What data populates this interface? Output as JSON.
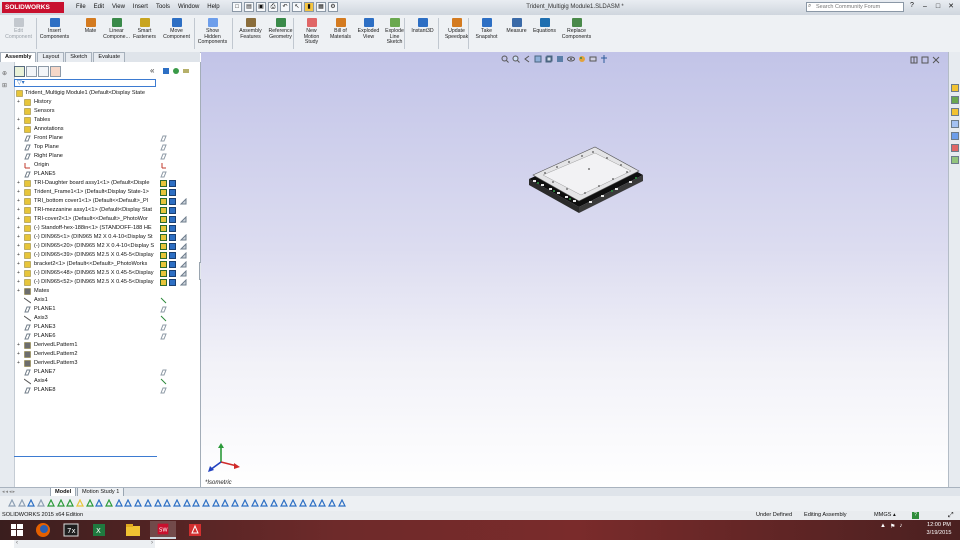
{
  "app": {
    "brand": "SOLIDWORKS",
    "document_title": "Trident_Multigig Module1.SLDASM *",
    "menu": [
      "File",
      "Edit",
      "View",
      "Insert",
      "Tools",
      "Window",
      "Help"
    ],
    "search_placeholder": "Search Community Forum",
    "window_controls": [
      "–",
      "□",
      "✕"
    ]
  },
  "commands": [
    {
      "label": "Edit\nComponent",
      "icon": "edit-component-icon",
      "enabled": false
    },
    {
      "label": "Insert\nComponents",
      "icon": "insert-components-icon",
      "enabled": true
    },
    {
      "label": "Mate",
      "icon": "mate-icon",
      "enabled": true
    },
    {
      "label": "Linear\nCompone...",
      "icon": "linear-pattern-icon",
      "enabled": true
    },
    {
      "label": "Smart\nFasteners",
      "icon": "smart-fasteners-icon",
      "enabled": true
    },
    {
      "label": "Move\nComponent",
      "icon": "move-component-icon",
      "enabled": true
    },
    {
      "label": "Show\nHidden\nComponents",
      "icon": "show-hidden-icon",
      "enabled": true
    },
    {
      "label": "Assembly\nFeatures",
      "icon": "assembly-features-icon",
      "enabled": true
    },
    {
      "label": "Reference\nGeometry",
      "icon": "reference-geometry-icon",
      "enabled": true
    },
    {
      "label": "New\nMotion\nStudy",
      "icon": "motion-study-icon",
      "enabled": true
    },
    {
      "label": "Bill of\nMaterials",
      "icon": "bom-icon",
      "enabled": true
    },
    {
      "label": "Exploded\nView",
      "icon": "exploded-view-icon",
      "enabled": true
    },
    {
      "label": "Explode\nLine\nSketch",
      "icon": "explode-line-icon",
      "enabled": true
    },
    {
      "label": "Instant3D",
      "icon": "instant3d-icon",
      "enabled": true
    },
    {
      "label": "Update\nSpeedpak",
      "icon": "speedpak-icon",
      "enabled": true
    },
    {
      "label": "Take\nSnapshot",
      "icon": "snapshot-icon",
      "enabled": true
    },
    {
      "label": "Measure",
      "icon": "measure-icon",
      "enabled": true
    },
    {
      "label": "Equations",
      "icon": "equations-icon",
      "enabled": true
    },
    {
      "label": "Replace\nComponents",
      "icon": "replace-components-icon",
      "enabled": true
    }
  ],
  "cm_tabs": [
    "Assembly",
    "Layout",
    "Sketch",
    "Evaluate"
  ],
  "feature_tree": {
    "filter_icon": "filter-icon",
    "nodes": [
      {
        "label": "Trident_Multigig Module1  (Default<Display State",
        "icon": "assembly",
        "expand": "",
        "indent": 0,
        "s": []
      },
      {
        "label": "History",
        "icon": "folder",
        "expand": "+",
        "indent": 1,
        "s": []
      },
      {
        "label": "Sensors",
        "icon": "folder",
        "expand": "",
        "indent": 1,
        "s": []
      },
      {
        "label": "Tables",
        "icon": "folder",
        "expand": "+",
        "indent": 1,
        "s": []
      },
      {
        "label": "Annotations",
        "icon": "annotation",
        "expand": "+",
        "indent": 1,
        "s": []
      },
      {
        "label": "Front Plane",
        "icon": "plane",
        "expand": "",
        "indent": 1,
        "s": [
          "eye"
        ]
      },
      {
        "label": "Top Plane",
        "icon": "plane",
        "expand": "",
        "indent": 1,
        "s": [
          "eye"
        ]
      },
      {
        "label": "Right Plane",
        "icon": "plane",
        "expand": "",
        "indent": 1,
        "s": [
          "eye"
        ]
      },
      {
        "label": "Origin",
        "icon": "origin",
        "expand": "",
        "indent": 1,
        "s": [
          "origin"
        ]
      },
      {
        "label": "PLANE5",
        "icon": "plane",
        "expand": "",
        "indent": 1,
        "s": [
          "eye"
        ]
      },
      {
        "label": "TRI-Daughter board assy1<1> (Default<Disple",
        "icon": "subassy",
        "expand": "+",
        "indent": 1,
        "s": [
          "part",
          "blue"
        ]
      },
      {
        "label": "Trident_Frame1<1> (Default<Display State-1>",
        "icon": "part",
        "expand": "+",
        "indent": 1,
        "s": [
          "part",
          "blue"
        ]
      },
      {
        "label": "TRI_bottom cover1<1> (Default<<Default>_Pl",
        "icon": "part",
        "expand": "+",
        "indent": 1,
        "s": [
          "part",
          "blue",
          "mirror"
        ]
      },
      {
        "label": "TRI-mezzanine assy1<1> (Default<Display Stat",
        "icon": "subassy",
        "expand": "+",
        "indent": 1,
        "s": [
          "part",
          "blue"
        ]
      },
      {
        "label": "TRI-cover2<1> (Default<<Default>_PhotoWor",
        "icon": "part",
        "expand": "+",
        "indent": 1,
        "s": [
          "part",
          "blue",
          "mirror"
        ]
      },
      {
        "label": "(-) Standoff-hex-188in<1> (STANDOFF-188 HE",
        "icon": "part",
        "expand": "+",
        "indent": 1,
        "s": [
          "part",
          "blue"
        ]
      },
      {
        "label": "(-) DIN965<1> (DIN965 M2 X 0.4-10<Display St",
        "icon": "part",
        "expand": "+",
        "indent": 1,
        "s": [
          "part",
          "blue",
          "mirror"
        ]
      },
      {
        "label": "(-) DIN965<20> (DIN965 M2 X 0.4-10<Display S",
        "icon": "part",
        "expand": "+",
        "indent": 1,
        "s": [
          "part",
          "blue",
          "mirror"
        ]
      },
      {
        "label": "(-) DIN965<39> (DIN965 M2.5 X 0.45-5<Display",
        "icon": "part",
        "expand": "+",
        "indent": 1,
        "s": [
          "part",
          "blue",
          "mirror"
        ]
      },
      {
        "label": "bracket2<1> (Default<<Default>_PhotoWorks",
        "icon": "part",
        "expand": "+",
        "indent": 1,
        "s": [
          "part",
          "blue",
          "mirror"
        ]
      },
      {
        "label": "(-) DIN965<48> (DIN965 M2.5 X 0.45-5<Display",
        "icon": "part",
        "expand": "+",
        "indent": 1,
        "s": [
          "part",
          "blue",
          "mirror"
        ]
      },
      {
        "label": "(-) DIN965<52> (DIN965 M2.5 X 0.45-5<Display",
        "icon": "part",
        "expand": "+",
        "indent": 1,
        "s": [
          "part",
          "blue",
          "mirror"
        ]
      },
      {
        "label": "Mates",
        "icon": "mates",
        "expand": "+",
        "indent": 1,
        "s": []
      },
      {
        "label": "Axis1",
        "icon": "axis",
        "expand": "",
        "indent": 1,
        "s": [
          "axis"
        ]
      },
      {
        "label": "PLANE1",
        "icon": "plane",
        "expand": "",
        "indent": 1,
        "s": [
          "eye"
        ]
      },
      {
        "label": "Axis3",
        "icon": "axis",
        "expand": "",
        "indent": 1,
        "s": [
          "axis"
        ]
      },
      {
        "label": "PLANE3",
        "icon": "plane",
        "expand": "",
        "indent": 1,
        "s": [
          "eye"
        ]
      },
      {
        "label": "PLANE6",
        "icon": "plane",
        "expand": "",
        "indent": 1,
        "s": [
          "eye"
        ]
      },
      {
        "label": "DerivedLPattern1",
        "icon": "pattern",
        "expand": "+",
        "indent": 1,
        "s": []
      },
      {
        "label": "DerivedLPattern2",
        "icon": "pattern",
        "expand": "+",
        "indent": 1,
        "s": []
      },
      {
        "label": "DerivedLPattern3",
        "icon": "pattern",
        "expand": "+",
        "indent": 1,
        "s": []
      },
      {
        "label": "PLANE7",
        "icon": "plane",
        "expand": "",
        "indent": 1,
        "s": [
          "eye"
        ]
      },
      {
        "label": "Axis4",
        "icon": "axis",
        "expand": "",
        "indent": 1,
        "s": [
          "axis"
        ]
      },
      {
        "label": "PLANE8",
        "icon": "plane",
        "expand": "",
        "indent": 1,
        "s": [
          "eye"
        ]
      }
    ]
  },
  "graphics": {
    "view_label": "*Isometric",
    "triad_axes": [
      "x",
      "y",
      "z"
    ]
  },
  "bottom_tabs": [
    "Model",
    "Motion Study 1"
  ],
  "status": {
    "edition": "SOLIDWORKS 2015 x64 Edition",
    "definition": "Under Defined",
    "mode": "Editing Assembly",
    "units": "MMGS",
    "units_arrow": "▴",
    "help": "?"
  },
  "taskbar": {
    "apps": [
      "windows-start",
      "firefox",
      "calculator-tools",
      "excel",
      "file-explorer",
      "solidworks",
      "acrobat"
    ],
    "time": "12:00 PM",
    "date": "3/19/2015"
  },
  "colors": {
    "brand": "#c8102e",
    "accent": "#3d7bd1",
    "taskbar": "#6e2a2a"
  }
}
